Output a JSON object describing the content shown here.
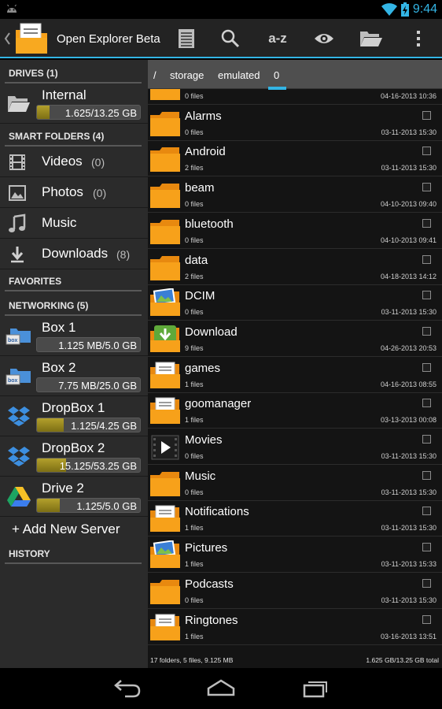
{
  "status": {
    "time": "9:44"
  },
  "app": {
    "title": "Open Explorer Beta"
  },
  "actionbar": {
    "sort_label": "a-z"
  },
  "sidebar": {
    "drives_header": "DRIVES (1)",
    "internal": {
      "name": "Internal",
      "usage": "1.625/13.25 GB",
      "fraction": 0.12
    },
    "smart_header": "SMART FOLDERS (4)",
    "smart": [
      {
        "label": "Videos",
        "count": "(0)"
      },
      {
        "label": "Photos",
        "count": "(0)"
      },
      {
        "label": "Music",
        "count": ""
      },
      {
        "label": "Downloads",
        "count": "(8)"
      }
    ],
    "favorites_header": "FAVORITES",
    "networking_header": "NETWORKING (5)",
    "servers": [
      {
        "name": "Box 1",
        "usage": "1.125 MB/5.0 GB",
        "fraction": 0.0
      },
      {
        "name": "Box 2",
        "usage": "7.75 MB/25.0 GB",
        "fraction": 0.0
      },
      {
        "name": "DropBox 1",
        "usage": "1.125/4.25 GB",
        "fraction": 0.26
      },
      {
        "name": "DropBox 2",
        "usage": "15.125/53.25 GB",
        "fraction": 0.28
      },
      {
        "name": "Drive 2",
        "usage": "1.125/5.0 GB",
        "fraction": 0.22
      }
    ],
    "add_server": "+ Add New Server",
    "history_header": "HISTORY"
  },
  "breadcrumbs": {
    "root": "/",
    "c1": "storage",
    "c2": "emulated",
    "c3": "0"
  },
  "files": [
    {
      "name": "",
      "count": "0 files",
      "date": "04-16-2013 10:36",
      "icon": "folder-icon"
    },
    {
      "name": "Alarms",
      "count": "0 files",
      "date": "03-11-2013 15:30",
      "icon": "folder-icon"
    },
    {
      "name": "Android",
      "count": "2 files",
      "date": "03-11-2013 15:30",
      "icon": "folder-icon"
    },
    {
      "name": "beam",
      "count": "0 files",
      "date": "04-10-2013 09:40",
      "icon": "folder-icon"
    },
    {
      "name": "bluetooth",
      "count": "0 files",
      "date": "04-10-2013 09:41",
      "icon": "folder-icon"
    },
    {
      "name": "data",
      "count": "2 files",
      "date": "04-18-2013 14:12",
      "icon": "folder-icon"
    },
    {
      "name": "DCIM",
      "count": "0 files",
      "date": "03-11-2013 15:30",
      "icon": "photo-folder-icon"
    },
    {
      "name": "Download",
      "count": "9 files",
      "date": "04-26-2013 20:53",
      "icon": "download-folder-icon"
    },
    {
      "name": "games",
      "count": "1 files",
      "date": "04-16-2013 08:55",
      "icon": "document-folder-icon"
    },
    {
      "name": "goomanager",
      "count": "1 files",
      "date": "03-13-2013 00:08",
      "icon": "document-folder-icon"
    },
    {
      "name": "Movies",
      "count": "0 files",
      "date": "03-11-2013 15:30",
      "icon": "movie-folder-icon"
    },
    {
      "name": "Music",
      "count": "0 files",
      "date": "03-11-2013 15:30",
      "icon": "folder-icon"
    },
    {
      "name": "Notifications",
      "count": "1 files",
      "date": "03-11-2013 15:30",
      "icon": "document-folder-icon"
    },
    {
      "name": "Pictures",
      "count": "1 files",
      "date": "03-11-2013 15:33",
      "icon": "photo-folder-icon"
    },
    {
      "name": "Podcasts",
      "count": "0 files",
      "date": "03-11-2013 15:30",
      "icon": "folder-icon"
    },
    {
      "name": "Ringtones",
      "count": "1 files",
      "date": "03-16-2013 13:51",
      "icon": "document-folder-icon"
    }
  ],
  "footer": {
    "left": "17 folders, 5 files, 9.125 MB",
    "right": "1.625 GB/13.25 GB total"
  },
  "colors": {
    "accent": "#33b5e5",
    "folder": "#f7a11a",
    "usage_fill": "#a8962a"
  }
}
